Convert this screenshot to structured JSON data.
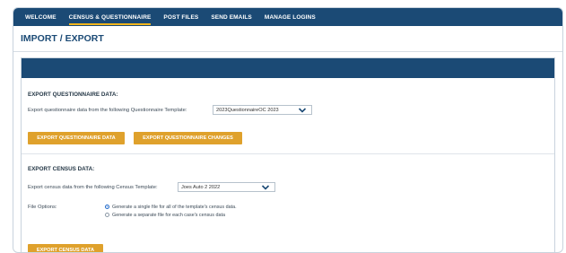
{
  "nav": {
    "items": [
      {
        "label": "WELCOME",
        "active": false
      },
      {
        "label": "CENSUS & QUESTIONNAIRE",
        "active": true
      },
      {
        "label": "POST FILES",
        "active": false
      },
      {
        "label": "SEND EMAILS",
        "active": false
      },
      {
        "label": "MANAGE LOGINS",
        "active": false
      }
    ],
    "active_underline_color": "#f1b51c"
  },
  "page": {
    "title": "IMPORT / EXPORT"
  },
  "questionnaire": {
    "section_title": "EXPORT QUESTIONNAIRE DATA:",
    "template_label": "Export questionnaire data from the following Questionnaire Template:",
    "template_value": "2023QuestionnaireOC 2023",
    "export_data_button": "EXPORT QUESTIONNAIRE DATA",
    "export_changes_button": "EXPORT QUESTIONNAIRE CHANGES"
  },
  "census": {
    "section_title": "EXPORT CENSUS DATA:",
    "template_label": "Export census data from the following Census Template:",
    "template_value": "Joes Auto 2 2022",
    "file_options_label": "File Options:",
    "option_single": "Generate a single file for all of the template's census data.",
    "option_separate": "Generate a separate file for each case's census data",
    "selected_option": "single",
    "export_button": "EXPORT CENSUS DATA"
  },
  "colors": {
    "brand_navy": "#1b4a75",
    "button_gold": "#dfa12c"
  }
}
